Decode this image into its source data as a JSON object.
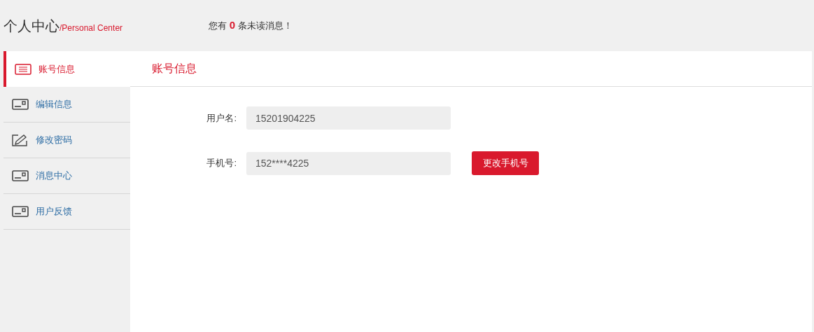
{
  "header": {
    "title": "个人中心",
    "subtitle": "/Personal Center",
    "message": "您有 **0** 条未读消息！"
  },
  "sidebar": {
    "items": [
      {
        "label": "账号信息",
        "selected": true
      },
      {
        "label": "编辑信息",
        "selected": false
      },
      {
        "label": "修改密码",
        "selected": false
      },
      {
        "label": "消息中心",
        "selected": false
      },
      {
        "label": "用户反馈",
        "selected": false
      }
    ]
  },
  "panel": {
    "title": "账号信息",
    "fields": [
      {
        "label": "用户名:",
        "value": "15201904225"
      },
      {
        "label": "手机号:",
        "value": "152****4225",
        "button": "更改手机号"
      }
    ]
  }
}
